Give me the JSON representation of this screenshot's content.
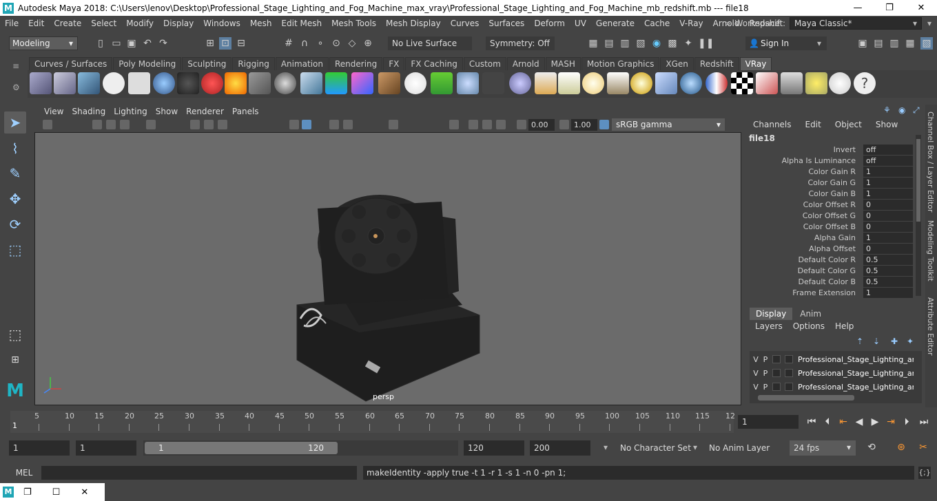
{
  "window": {
    "title": "Autodesk Maya 2018: C:\\Users\\lenov\\Desktop\\Professional_Stage_Lighting_and_Fog_Machine_max_vray\\Professional_Stage_Lighting_and_Fog_Machine_mb_redshift.mb  ---  file18",
    "logo": "M",
    "minimize": "—",
    "maximize": "❐",
    "close": "✕"
  },
  "menubar": [
    "File",
    "Edit",
    "Create",
    "Select",
    "Modify",
    "Display",
    "Windows",
    "Mesh",
    "Edit Mesh",
    "Mesh Tools",
    "Mesh Display",
    "Curves",
    "Surfaces",
    "Deform",
    "UV",
    "Generate",
    "Cache",
    "V-Ray",
    "Arnold",
    "Redshift"
  ],
  "workspace": {
    "label": "Workspace :",
    "value": "Maya Classic*",
    "more": "»"
  },
  "statusline": {
    "mode": "Modeling",
    "live_surface": "No Live Surface",
    "symmetry": "Symmetry: Off",
    "sign_in": "Sign In"
  },
  "shelf": {
    "tabs": [
      "Curves / Surfaces",
      "Poly Modeling",
      "Sculpting",
      "Rigging",
      "Animation",
      "Rendering",
      "FX",
      "FX Caching",
      "Custom",
      "Arnold",
      "MASH",
      "Motion Graphics",
      "XGen",
      "Redshift",
      "VRay"
    ],
    "active_tab": "VRay"
  },
  "viewport": {
    "menu": [
      "View",
      "Shading",
      "Lighting",
      "Show",
      "Renderer",
      "Panels"
    ],
    "near": "0.00",
    "gamma_value": "1.00",
    "color_space": "sRGB gamma",
    "camera": "persp"
  },
  "channel_box": {
    "menu": [
      "Channels",
      "Edit",
      "Object",
      "Show"
    ],
    "node": "file18",
    "attributes": [
      {
        "name": "Invert",
        "value": "off"
      },
      {
        "name": "Alpha Is Luminance",
        "value": "off"
      },
      {
        "name": "Color Gain R",
        "value": "1"
      },
      {
        "name": "Color Gain G",
        "value": "1"
      },
      {
        "name": "Color Gain B",
        "value": "1"
      },
      {
        "name": "Color Offset R",
        "value": "0"
      },
      {
        "name": "Color Offset G",
        "value": "0"
      },
      {
        "name": "Color Offset B",
        "value": "0"
      },
      {
        "name": "Alpha Gain",
        "value": "1"
      },
      {
        "name": "Alpha Offset",
        "value": "0"
      },
      {
        "name": "Default Color R",
        "value": "0.5"
      },
      {
        "name": "Default Color G",
        "value": "0.5"
      },
      {
        "name": "Default Color B",
        "value": "0.5"
      },
      {
        "name": "Frame Extension",
        "value": "1"
      }
    ]
  },
  "layer_editor": {
    "tabs": [
      "Display",
      "Anim"
    ],
    "active_tab": "Display",
    "menu": [
      "Layers",
      "Options",
      "Help"
    ],
    "layers": [
      {
        "v": "V",
        "p": "P",
        "name": "Professional_Stage_Lighting_and"
      },
      {
        "v": "V",
        "p": "P",
        "name": "Professional_Stage_Lighting_and"
      },
      {
        "v": "V",
        "p": "P",
        "name": "Professional_Stage_Lighting_and"
      }
    ]
  },
  "side_tabs": [
    "Channel Box / Layer Editor",
    "Modeling Toolkit",
    "Attribute Editor"
  ],
  "timeline": {
    "ticks": [
      "5",
      "10",
      "15",
      "20",
      "25",
      "30",
      "35",
      "40",
      "45",
      "50",
      "55",
      "60",
      "65",
      "70",
      "75",
      "80",
      "85",
      "90",
      "95",
      "100",
      "105",
      "110",
      "115",
      "12"
    ],
    "start_marker": "1",
    "current_frame": "1"
  },
  "range": {
    "start": "1",
    "anim_start": "1",
    "range_start": "1",
    "range_end": "120",
    "anim_end": "120",
    "end": "200",
    "character_set": "No Character Set",
    "anim_layer": "No Anim Layer",
    "fps": "24 fps"
  },
  "command_line": {
    "label": "MEL",
    "result": "makeIdentity -apply true -t 1 -r 1 -s 1 -n 0 -pn 1;"
  }
}
